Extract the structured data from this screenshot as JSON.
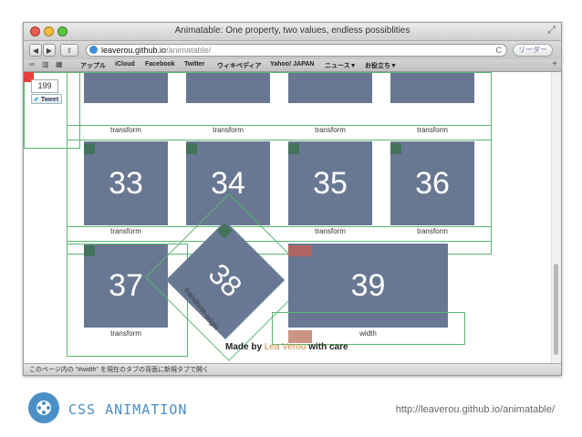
{
  "window": {
    "title": "Animatable: One property, two values, endless possiblities"
  },
  "toolbar": {
    "back": "◀",
    "forward": "▶",
    "share": "⇪",
    "url_host": "leaverou.github.io",
    "url_path": "/animatable/",
    "reload": "C",
    "reader": "リーダー"
  },
  "bookmarks": {
    "items": [
      "アップル",
      "iCloud",
      "Facebook",
      "Twitter",
      "ウィキペディア",
      "Yahoo! JAPAN",
      "ニュース▼",
      "お役立ち▼"
    ]
  },
  "page": {
    "counter": "199",
    "tweet": "Tweet",
    "tiles": [
      "33",
      "34",
      "35",
      "36",
      "37",
      "38",
      "39"
    ],
    "captions": {
      "transform": "transform",
      "transform_origin": "transform-origin",
      "width": "width"
    },
    "made_by_prefix": "Made by",
    "author": "Lea Verou",
    "made_by_suffix": "with care"
  },
  "statusbar": {
    "text": "このページ内の \"#width\" を現在のタブの背面に新規タブで開く"
  },
  "footer": {
    "title": "CSS ANIMATION",
    "url": "http://leaverou.github.io/animatable/"
  },
  "colors": {
    "tile": "#687892",
    "outline": "#5bb672",
    "accent": "#4a90c6"
  }
}
